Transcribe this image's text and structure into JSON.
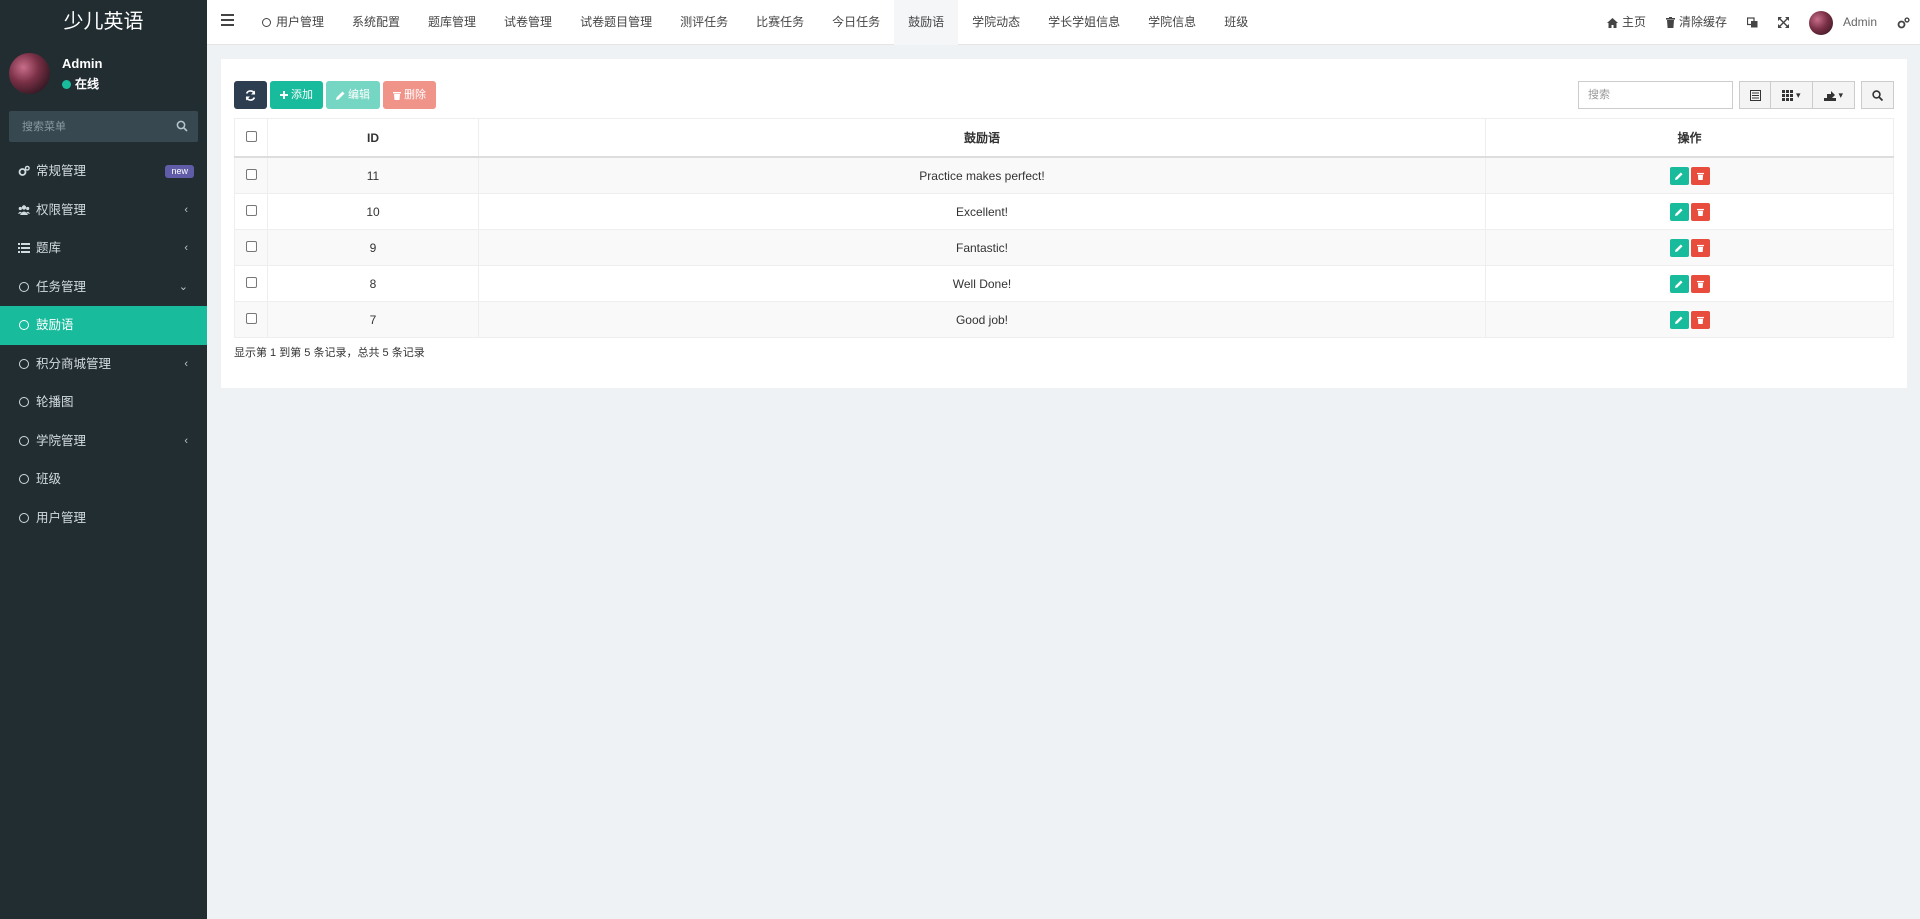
{
  "app": {
    "title": "少儿英语"
  },
  "user": {
    "name": "Admin",
    "status": "在线"
  },
  "sidebar": {
    "search_placeholder": "搜索菜单",
    "items": [
      {
        "label": "常规管理",
        "icon": "cogs-icon",
        "badge": "new"
      },
      {
        "label": "权限管理",
        "icon": "users-icon",
        "arrow": "‹"
      },
      {
        "label": "题库",
        "icon": "list-icon",
        "arrow": "‹"
      },
      {
        "label": "任务管理",
        "icon": "circle-icon",
        "arrow": "⌄"
      },
      {
        "label": "鼓励语",
        "icon": "circle-icon",
        "active": true
      },
      {
        "label": "积分商城管理",
        "icon": "circle-icon",
        "arrow": "‹"
      },
      {
        "label": "轮播图",
        "icon": "circle-icon"
      },
      {
        "label": "学院管理",
        "icon": "circle-icon",
        "arrow": "‹"
      },
      {
        "label": "班级",
        "icon": "circle-icon"
      },
      {
        "label": "用户管理",
        "icon": "circle-icon"
      }
    ]
  },
  "topnav": {
    "tabs": [
      "用户管理",
      "系统配置",
      "题库管理",
      "试卷管理",
      "试卷题目管理",
      "测评任务",
      "比赛任务",
      "今日任务",
      "鼓励语",
      "学院动态",
      "学长学姐信息",
      "学院信息",
      "班级"
    ],
    "active_tab": "鼓励语",
    "home": "主页",
    "clear_cache": "清除缓存",
    "user_name": "Admin"
  },
  "toolbar": {
    "add": "添加",
    "edit": "编辑",
    "delete": "删除",
    "search_placeholder": "搜索"
  },
  "table": {
    "headers": {
      "id": "ID",
      "text": "鼓励语",
      "ops": "操作"
    },
    "rows": [
      {
        "id": "11",
        "text": "Practice makes perfect!"
      },
      {
        "id": "10",
        "text": "Excellent!"
      },
      {
        "id": "9",
        "text": "Fantastic!"
      },
      {
        "id": "8",
        "text": "Well Done!"
      },
      {
        "id": "7",
        "text": "Good job!"
      }
    ]
  },
  "pagination": {
    "summary": "显示第 1 到第 5 条记录，总共 5 条记录"
  },
  "colors": {
    "sidebar_bg": "#222d32",
    "accent": "#18bc9c",
    "danger": "#e74c3c",
    "refresh": "#2c3e50",
    "badge": "#605ca8"
  }
}
